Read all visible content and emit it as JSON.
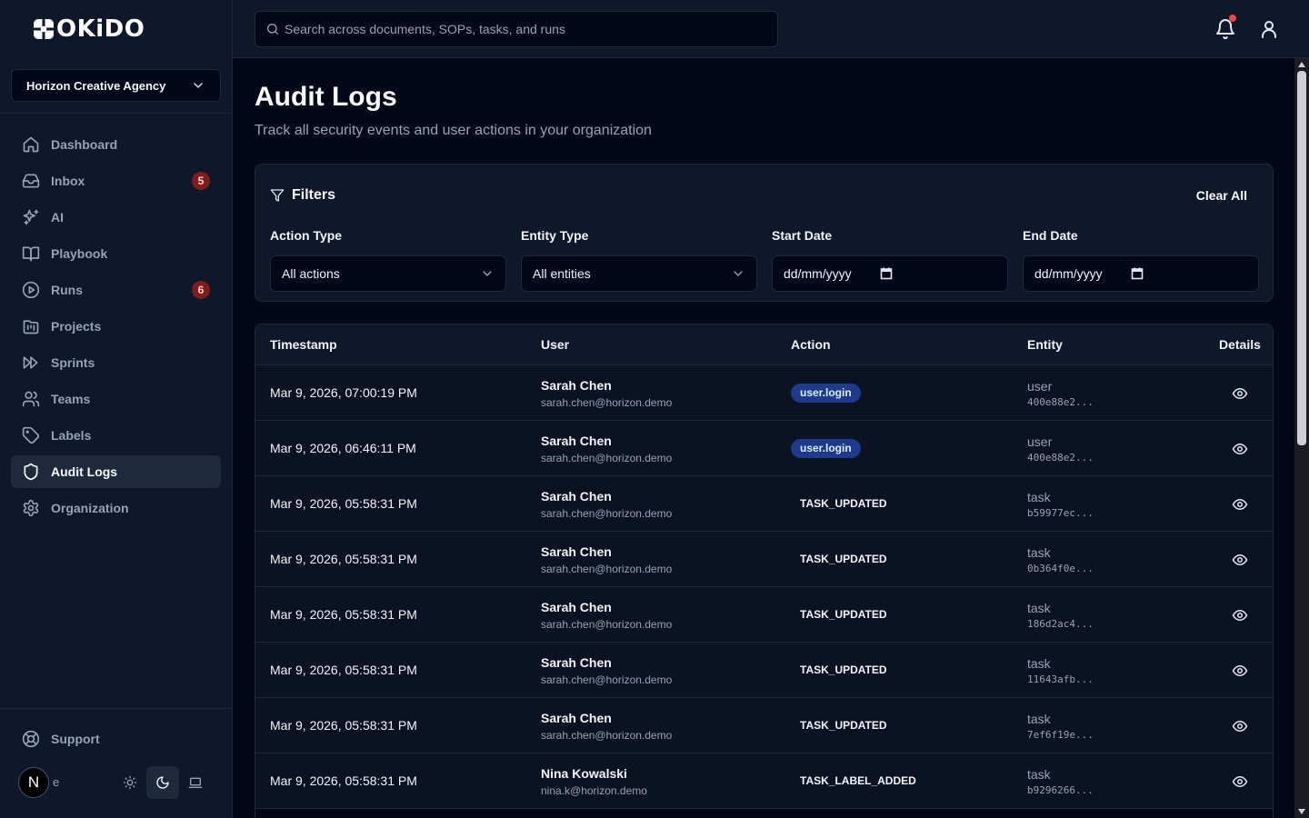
{
  "brand": {
    "name": "OKiDO"
  },
  "sidebar": {
    "org": "Horizon Creative Agency",
    "items": [
      {
        "label": "Dashboard",
        "icon": "home-icon",
        "badge": ""
      },
      {
        "label": "Inbox",
        "icon": "inbox-icon",
        "badge": "5"
      },
      {
        "label": "AI",
        "icon": "sparkles-icon",
        "badge": ""
      },
      {
        "label": "Playbook",
        "icon": "book-open-icon",
        "badge": ""
      },
      {
        "label": "Runs",
        "icon": "play-circle-icon",
        "badge": "6"
      },
      {
        "label": "Projects",
        "icon": "kanban-icon",
        "badge": ""
      },
      {
        "label": "Sprints",
        "icon": "fast-forward-icon",
        "badge": ""
      },
      {
        "label": "Teams",
        "icon": "users-icon",
        "badge": ""
      },
      {
        "label": "Labels",
        "icon": "tag-icon",
        "badge": ""
      },
      {
        "label": "Audit Logs",
        "icon": "shield-icon",
        "badge": ""
      },
      {
        "label": "Organization",
        "icon": "gear-icon",
        "badge": ""
      }
    ],
    "support": "Support",
    "avatar_initial": "N",
    "avatar_tail": "e"
  },
  "topbar": {
    "search_placeholder": "Search across documents, SOPs, tasks, and runs"
  },
  "page": {
    "title": "Audit Logs",
    "subtitle": "Track all security events and user actions in your organization"
  },
  "filters": {
    "title": "Filters",
    "clear": "Clear All",
    "action_type": {
      "label": "Action Type",
      "value": "All actions"
    },
    "entity_type": {
      "label": "Entity Type",
      "value": "All entities"
    },
    "start_date": {
      "label": "Start Date",
      "value": "dd/mm/yyyy"
    },
    "end_date": {
      "label": "End Date",
      "value": "dd/mm/yyyy"
    }
  },
  "table": {
    "headers": {
      "timestamp": "Timestamp",
      "user": "User",
      "action": "Action",
      "entity": "Entity",
      "details": "Details"
    },
    "rows": [
      {
        "ts": "Mar 9, 2026, 07:00:19 PM",
        "name": "Sarah Chen",
        "email": "sarah.chen@horizon.demo",
        "action": "user.login",
        "pill": true,
        "etype": "user",
        "eid": "400e88e2..."
      },
      {
        "ts": "Mar 9, 2026, 06:46:11 PM",
        "name": "Sarah Chen",
        "email": "sarah.chen@horizon.demo",
        "action": "user.login",
        "pill": true,
        "etype": "user",
        "eid": "400e88e2..."
      },
      {
        "ts": "Mar 9, 2026, 05:58:31 PM",
        "name": "Sarah Chen",
        "email": "sarah.chen@horizon.demo",
        "action": "TASK_UPDATED",
        "pill": false,
        "etype": "task",
        "eid": "b59977ec..."
      },
      {
        "ts": "Mar 9, 2026, 05:58:31 PM",
        "name": "Sarah Chen",
        "email": "sarah.chen@horizon.demo",
        "action": "TASK_UPDATED",
        "pill": false,
        "etype": "task",
        "eid": "0b364f0e..."
      },
      {
        "ts": "Mar 9, 2026, 05:58:31 PM",
        "name": "Sarah Chen",
        "email": "sarah.chen@horizon.demo",
        "action": "TASK_UPDATED",
        "pill": false,
        "etype": "task",
        "eid": "186d2ac4..."
      },
      {
        "ts": "Mar 9, 2026, 05:58:31 PM",
        "name": "Sarah Chen",
        "email": "sarah.chen@horizon.demo",
        "action": "TASK_UPDATED",
        "pill": false,
        "etype": "task",
        "eid": "11643afb..."
      },
      {
        "ts": "Mar 9, 2026, 05:58:31 PM",
        "name": "Sarah Chen",
        "email": "sarah.chen@horizon.demo",
        "action": "TASK_UPDATED",
        "pill": false,
        "etype": "task",
        "eid": "7ef6f19e..."
      },
      {
        "ts": "Mar 9, 2026, 05:58:31 PM",
        "name": "Nina Kowalski",
        "email": "nina.k@horizon.demo",
        "action": "TASK_LABEL_ADDED",
        "pill": false,
        "etype": "task",
        "eid": "b9296266..."
      }
    ]
  },
  "colors": {
    "background": "#020817",
    "panel": "#0f172a",
    "border": "#1e293b",
    "badge": "#7f1d1d",
    "pill": "#1e3a8a",
    "notification": "#ef4444"
  }
}
